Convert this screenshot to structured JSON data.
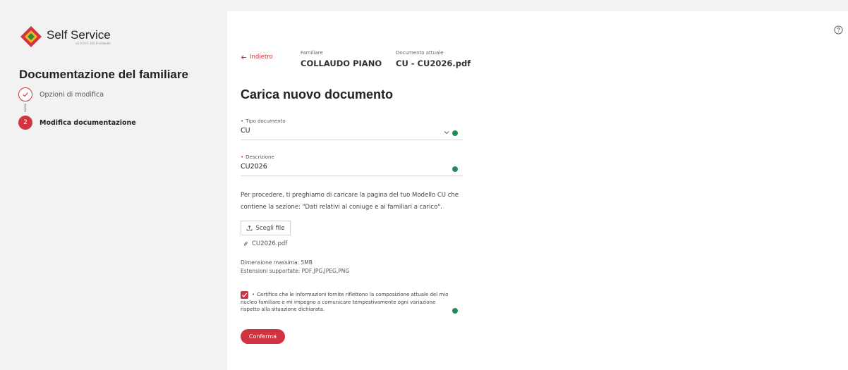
{
  "app": {
    "name": "Self Service",
    "version": "v1.0.0+1.322.0-collaudo"
  },
  "sidebar": {
    "title": "Documentazione del familiare",
    "steps": [
      {
        "label": "Opzioni di modifica",
        "number": "",
        "status": "done"
      },
      {
        "label": "Modifica documentazione",
        "number": "2",
        "status": "current"
      }
    ]
  },
  "header": {
    "back_label": "Indietro",
    "familiare_label": "Familiare",
    "familiare_value": "COLLAUDO PIANO",
    "document_label": "Documento attuale",
    "document_value": "CU - CU2026.pdf"
  },
  "form": {
    "title": "Carica nuovo documento",
    "tipo_documento": {
      "label": "Tipo documento",
      "value": "CU"
    },
    "descrizione": {
      "label": "Descrizione",
      "value": "CU2026"
    },
    "instruction": "Per procedere, ti preghiamo di caricare la pagina del tuo Modello CU che contiene la sezione: \"Dati relativi al coniuge e ai familiari a carico\".",
    "upload_label": "Scegli file",
    "file_name": "CU2026.pdf",
    "max_size": "Dimensione massima: 5MB",
    "extensions": "Estensioni supportate: PDF,JPG,JPEG,PNG",
    "certification": "Certifico che le informazioni fornite riflettono la composizione attuale del mio nucleo familiare e mi impegno a comunicare tempestivamente ogni variazione rispetto alla situazione dichiarata.",
    "certification_checked": true,
    "confirm_label": "Conferma"
  },
  "colors": {
    "accent": "#d13440",
    "success": "#228b5a",
    "sidebar_bg": "#f2f2f2"
  },
  "icons": [
    "logo-icon",
    "check-icon",
    "help-icon",
    "arrow-left-icon",
    "chevron-down-icon",
    "success-icon",
    "upload-icon",
    "paperclip-icon"
  ]
}
